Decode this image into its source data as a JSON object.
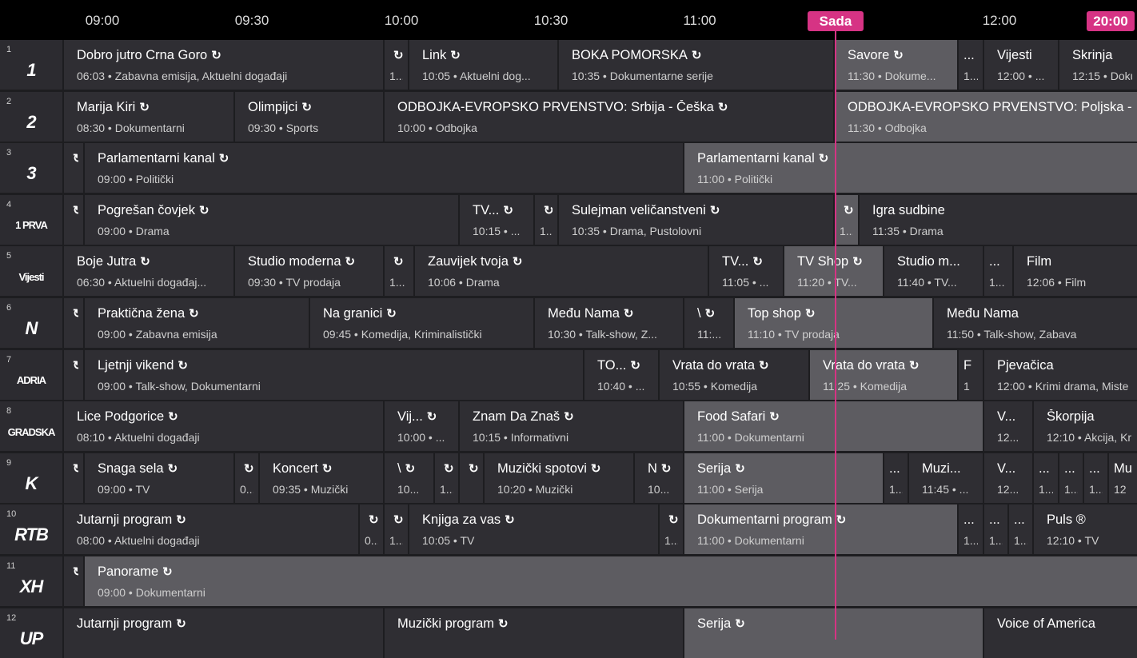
{
  "timeline": {
    "ticks": [
      "09:00",
      "09:30",
      "10:00",
      "10:30",
      "11:00",
      "11:30",
      "12:00"
    ],
    "now_label": "Sada",
    "clock": "20:00"
  },
  "channels": [
    {
      "num": "1",
      "logo": "1",
      "programs": [
        {
          "title": "Dobro jutro Crna Goro",
          "sub": "06:03 • Zabavna emisija, Aktuelni događaji",
          "replay": true
        },
        {
          "title": "",
          "sub": "1...",
          "replay": true
        },
        {
          "title": "Link",
          "sub": "10:05 • Aktuelni dog...",
          "replay": true
        },
        {
          "title": "BOKA POMORSKA",
          "sub": "10:35 • Dokumentarne serije",
          "replay": true
        },
        {
          "title": "Savore",
          "sub": "11:30 • Dokume...",
          "replay": true,
          "now": true
        },
        {
          "title": "...",
          "sub": "1...",
          "replay": false
        },
        {
          "title": "Vijesti",
          "sub": "12:00 • ...",
          "replay": false
        },
        {
          "title": "Skrinja",
          "sub": "12:15 • Doku",
          "replay": false
        }
      ]
    },
    {
      "num": "2",
      "logo": "2",
      "programs": [
        {
          "title": "Marija Kiri",
          "sub": "08:30 • Dokumentarni",
          "replay": true
        },
        {
          "title": "Olimpijci",
          "sub": "09:30 • Sports",
          "replay": true
        },
        {
          "title": "ODBOJKA-EVROPSKO PRVENSTVO: Srbija - Češka",
          "sub": "10:00 • Odbojka",
          "replay": true
        },
        {
          "title": "ODBOJKA-EVROPSKO PRVENSTVO: Poljska - B",
          "sub": "11:30 • Odbojka",
          "replay": false,
          "now": true
        }
      ]
    },
    {
      "num": "3",
      "logo": "3",
      "programs": [
        {
          "title": "",
          "sub": "",
          "replay": true
        },
        {
          "title": "Parlamentarni kanal",
          "sub": "09:00 • Politički",
          "replay": true
        },
        {
          "title": "Parlamentarni kanal",
          "sub": "11:00 • Politički",
          "replay": true,
          "now": true
        }
      ]
    },
    {
      "num": "4",
      "logo": "1 PRVA",
      "programs": [
        {
          "title": "",
          "sub": "",
          "replay": true
        },
        {
          "title": "Pogrešan čovjek",
          "sub": "09:00 • Drama",
          "replay": true
        },
        {
          "title": "TV...",
          "sub": "10:15 • ...",
          "replay": true
        },
        {
          "title": "",
          "sub": "1...",
          "replay": true
        },
        {
          "title": "Sulejman veličanstveni",
          "sub": "10:35 • Drama, Pustolovni",
          "replay": true
        },
        {
          "title": "",
          "sub": "1...",
          "replay": true,
          "now": true
        },
        {
          "title": "Igra sudbine",
          "sub": "11:35 • Drama",
          "replay": false
        }
      ]
    },
    {
      "num": "5",
      "logo": "Vijesti",
      "programs": [
        {
          "title": "Boje Jutra",
          "sub": "06:30 • Aktuelni događaj...",
          "replay": true
        },
        {
          "title": "Studio moderna",
          "sub": "09:30 • TV prodaja",
          "replay": true
        },
        {
          "title": "",
          "sub": "1...",
          "replay": true
        },
        {
          "title": "Zauvijek tvoja",
          "sub": "10:06 • Drama",
          "replay": true
        },
        {
          "title": "TV...",
          "sub": "11:05 • ...",
          "replay": true
        },
        {
          "title": "TV Shop",
          "sub": "11:20 • TV...",
          "replay": true,
          "now": true
        },
        {
          "title": "Studio m...",
          "sub": "11:40 • TV...",
          "replay": false
        },
        {
          "title": "...",
          "sub": "1...",
          "replay": false
        },
        {
          "title": "Film",
          "sub": "12:06 • Film",
          "replay": false
        }
      ]
    },
    {
      "num": "6",
      "logo": "N",
      "programs": [
        {
          "title": "",
          "sub": "",
          "replay": true
        },
        {
          "title": "Praktična žena",
          "sub": "09:00 • Zabavna emisija",
          "replay": true
        },
        {
          "title": "Na granici",
          "sub": "09:45 • Komedija, Kriminalistički",
          "replay": true
        },
        {
          "title": "Među Nama",
          "sub": "10:30 • Talk-show, Z...",
          "replay": true
        },
        {
          "title": "\\",
          "sub": "11:...",
          "replay": true
        },
        {
          "title": "Top shop",
          "sub": "11:10 • TV prodaja",
          "replay": true,
          "now": true
        },
        {
          "title": "Među Nama",
          "sub": "11:50 • Talk-show, Zabava",
          "replay": false
        }
      ]
    },
    {
      "num": "7",
      "logo": "ADRIA",
      "programs": [
        {
          "title": "",
          "sub": "",
          "replay": true
        },
        {
          "title": "Ljetnji vikend",
          "sub": "09:00 • Talk-show, Dokumentarni",
          "replay": true
        },
        {
          "title": "TO...",
          "sub": "10:40 • ...",
          "replay": true
        },
        {
          "title": "Vrata do vrata",
          "sub": "10:55 • Komedija",
          "replay": true
        },
        {
          "title": "Vrata do vrata",
          "sub": "11:25 • Komedija",
          "replay": true,
          "now": true
        },
        {
          "title": "F",
          "sub": "1",
          "replay": false
        },
        {
          "title": "Pjevačica",
          "sub": "12:00 • Krimi drama, Miste",
          "replay": false
        }
      ]
    },
    {
      "num": "8",
      "logo": "GRADSKA",
      "programs": [
        {
          "title": "Lice Podgorice",
          "sub": "08:10 • Aktuelni događaji",
          "replay": true
        },
        {
          "title": "Vij...",
          "sub": "10:00 • ...",
          "replay": true
        },
        {
          "title": "Znam Da Znaš",
          "sub": "10:15 • Informativni",
          "replay": true
        },
        {
          "title": "Food Safari",
          "sub": "11:00 • Dokumentarni",
          "replay": true,
          "now": true
        },
        {
          "title": "V...",
          "sub": "12...",
          "replay": false
        },
        {
          "title": "Škorpija",
          "sub": "12:10 • Akcija, Kr",
          "replay": false
        }
      ]
    },
    {
      "num": "9",
      "logo": "K",
      "programs": [
        {
          "title": "",
          "sub": "",
          "replay": true
        },
        {
          "title": "Snaga sela",
          "sub": "09:00 • TV",
          "replay": true
        },
        {
          "title": "",
          "sub": "0...",
          "replay": true
        },
        {
          "title": "Koncert",
          "sub": "09:35 • Muzički",
          "replay": true
        },
        {
          "title": "\\",
          "sub": "10...",
          "replay": true
        },
        {
          "title": "",
          "sub": "1...",
          "replay": true
        },
        {
          "title": "",
          "sub": "",
          "replay": true
        },
        {
          "title": "Muzički spotovi",
          "sub": "10:20 • Muzički",
          "replay": true
        },
        {
          "title": "N",
          "sub": "10...",
          "replay": true
        },
        {
          "title": "Serija",
          "sub": "11:00 • Serija",
          "replay": true,
          "now": true
        },
        {
          "title": "...",
          "sub": "1...",
          "replay": false
        },
        {
          "title": "Muzi...",
          "sub": "11:45 • ...",
          "replay": false
        },
        {
          "title": "V...",
          "sub": "12...",
          "replay": false
        },
        {
          "title": "...",
          "sub": "1...",
          "replay": false
        },
        {
          "title": "...",
          "sub": "1...",
          "replay": false
        },
        {
          "title": "...",
          "sub": "1...",
          "replay": false
        },
        {
          "title": "Mu",
          "sub": "12",
          "replay": false
        }
      ]
    },
    {
      "num": "10",
      "logo": "RTB",
      "programs": [
        {
          "title": "Jutarnji program",
          "sub": "08:00 • Aktuelni događaji",
          "replay": true
        },
        {
          "title": "",
          "sub": "0...",
          "replay": true
        },
        {
          "title": "",
          "sub": "1...",
          "replay": true
        },
        {
          "title": "Knjiga za vas",
          "sub": "10:05 • TV",
          "replay": true
        },
        {
          "title": "",
          "sub": "1...",
          "replay": true
        },
        {
          "title": "Dokumentarni program",
          "sub": "11:00 • Dokumentarni",
          "replay": true,
          "now": true
        },
        {
          "title": "...",
          "sub": "1...",
          "replay": false
        },
        {
          "title": "...",
          "sub": "1...",
          "replay": false
        },
        {
          "title": "...",
          "sub": "1...",
          "replay": false
        },
        {
          "title": "Puls ®",
          "sub": "12:10 • TV",
          "replay": false
        }
      ]
    },
    {
      "num": "11",
      "logo": "XH",
      "programs": [
        {
          "title": "",
          "sub": "",
          "replay": true
        },
        {
          "title": "Panorame",
          "sub": "09:00 • Dokumentarni",
          "replay": true,
          "now": true
        }
      ]
    },
    {
      "num": "12",
      "logo": "UP",
      "programs": [
        {
          "title": "Jutarnji program",
          "sub": "",
          "replay": true
        },
        {
          "title": "Muzički program",
          "sub": "",
          "replay": true
        },
        {
          "title": "Serija",
          "sub": "",
          "replay": true,
          "now": true
        },
        {
          "title": "Voice of America",
          "sub": "",
          "replay": false
        }
      ]
    }
  ]
}
